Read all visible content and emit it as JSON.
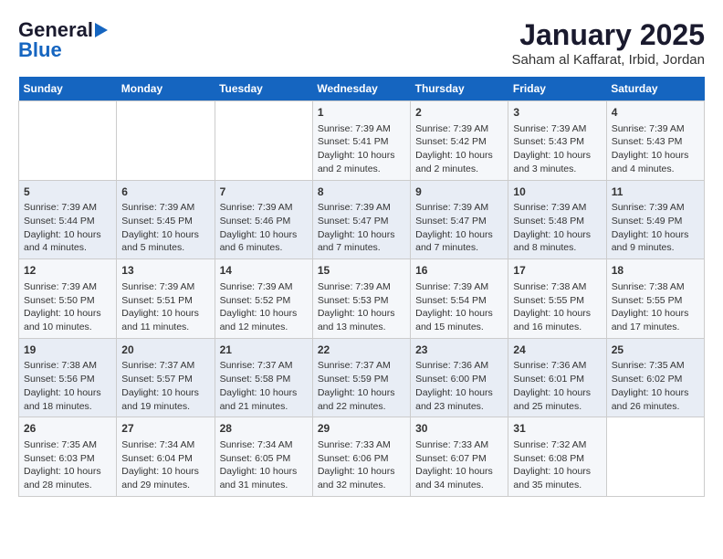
{
  "logo": {
    "line1": "General",
    "line2": "Blue",
    "arrow": true
  },
  "title": "January 2025",
  "subtitle": "Saham al Kaffarat, Irbid, Jordan",
  "weekdays": [
    "Sunday",
    "Monday",
    "Tuesday",
    "Wednesday",
    "Thursday",
    "Friday",
    "Saturday"
  ],
  "weeks": [
    [
      {
        "day": "",
        "info": ""
      },
      {
        "day": "",
        "info": ""
      },
      {
        "day": "",
        "info": ""
      },
      {
        "day": "1",
        "info": "Sunrise: 7:39 AM\nSunset: 5:41 PM\nDaylight: 10 hours and 2 minutes."
      },
      {
        "day": "2",
        "info": "Sunrise: 7:39 AM\nSunset: 5:42 PM\nDaylight: 10 hours and 2 minutes."
      },
      {
        "day": "3",
        "info": "Sunrise: 7:39 AM\nSunset: 5:43 PM\nDaylight: 10 hours and 3 minutes."
      },
      {
        "day": "4",
        "info": "Sunrise: 7:39 AM\nSunset: 5:43 PM\nDaylight: 10 hours and 4 minutes."
      }
    ],
    [
      {
        "day": "5",
        "info": "Sunrise: 7:39 AM\nSunset: 5:44 PM\nDaylight: 10 hours and 4 minutes."
      },
      {
        "day": "6",
        "info": "Sunrise: 7:39 AM\nSunset: 5:45 PM\nDaylight: 10 hours and 5 minutes."
      },
      {
        "day": "7",
        "info": "Sunrise: 7:39 AM\nSunset: 5:46 PM\nDaylight: 10 hours and 6 minutes."
      },
      {
        "day": "8",
        "info": "Sunrise: 7:39 AM\nSunset: 5:47 PM\nDaylight: 10 hours and 7 minutes."
      },
      {
        "day": "9",
        "info": "Sunrise: 7:39 AM\nSunset: 5:47 PM\nDaylight: 10 hours and 7 minutes."
      },
      {
        "day": "10",
        "info": "Sunrise: 7:39 AM\nSunset: 5:48 PM\nDaylight: 10 hours and 8 minutes."
      },
      {
        "day": "11",
        "info": "Sunrise: 7:39 AM\nSunset: 5:49 PM\nDaylight: 10 hours and 9 minutes."
      }
    ],
    [
      {
        "day": "12",
        "info": "Sunrise: 7:39 AM\nSunset: 5:50 PM\nDaylight: 10 hours and 10 minutes."
      },
      {
        "day": "13",
        "info": "Sunrise: 7:39 AM\nSunset: 5:51 PM\nDaylight: 10 hours and 11 minutes."
      },
      {
        "day": "14",
        "info": "Sunrise: 7:39 AM\nSunset: 5:52 PM\nDaylight: 10 hours and 12 minutes."
      },
      {
        "day": "15",
        "info": "Sunrise: 7:39 AM\nSunset: 5:53 PM\nDaylight: 10 hours and 13 minutes."
      },
      {
        "day": "16",
        "info": "Sunrise: 7:39 AM\nSunset: 5:54 PM\nDaylight: 10 hours and 15 minutes."
      },
      {
        "day": "17",
        "info": "Sunrise: 7:38 AM\nSunset: 5:55 PM\nDaylight: 10 hours and 16 minutes."
      },
      {
        "day": "18",
        "info": "Sunrise: 7:38 AM\nSunset: 5:55 PM\nDaylight: 10 hours and 17 minutes."
      }
    ],
    [
      {
        "day": "19",
        "info": "Sunrise: 7:38 AM\nSunset: 5:56 PM\nDaylight: 10 hours and 18 minutes."
      },
      {
        "day": "20",
        "info": "Sunrise: 7:37 AM\nSunset: 5:57 PM\nDaylight: 10 hours and 19 minutes."
      },
      {
        "day": "21",
        "info": "Sunrise: 7:37 AM\nSunset: 5:58 PM\nDaylight: 10 hours and 21 minutes."
      },
      {
        "day": "22",
        "info": "Sunrise: 7:37 AM\nSunset: 5:59 PM\nDaylight: 10 hours and 22 minutes."
      },
      {
        "day": "23",
        "info": "Sunrise: 7:36 AM\nSunset: 6:00 PM\nDaylight: 10 hours and 23 minutes."
      },
      {
        "day": "24",
        "info": "Sunrise: 7:36 AM\nSunset: 6:01 PM\nDaylight: 10 hours and 25 minutes."
      },
      {
        "day": "25",
        "info": "Sunrise: 7:35 AM\nSunset: 6:02 PM\nDaylight: 10 hours and 26 minutes."
      }
    ],
    [
      {
        "day": "26",
        "info": "Sunrise: 7:35 AM\nSunset: 6:03 PM\nDaylight: 10 hours and 28 minutes."
      },
      {
        "day": "27",
        "info": "Sunrise: 7:34 AM\nSunset: 6:04 PM\nDaylight: 10 hours and 29 minutes."
      },
      {
        "day": "28",
        "info": "Sunrise: 7:34 AM\nSunset: 6:05 PM\nDaylight: 10 hours and 31 minutes."
      },
      {
        "day": "29",
        "info": "Sunrise: 7:33 AM\nSunset: 6:06 PM\nDaylight: 10 hours and 32 minutes."
      },
      {
        "day": "30",
        "info": "Sunrise: 7:33 AM\nSunset: 6:07 PM\nDaylight: 10 hours and 34 minutes."
      },
      {
        "day": "31",
        "info": "Sunrise: 7:32 AM\nSunset: 6:08 PM\nDaylight: 10 hours and 35 minutes."
      },
      {
        "day": "",
        "info": ""
      }
    ]
  ]
}
